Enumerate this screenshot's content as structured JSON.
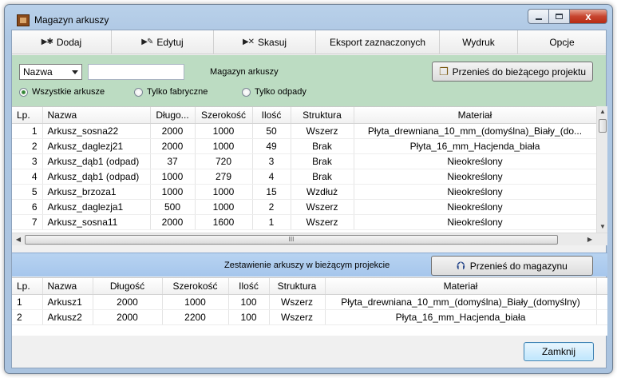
{
  "window": {
    "title": "Magazyn arkuszy",
    "close_glyph": "x"
  },
  "toolbar": {
    "items": [
      {
        "label": "Dodaj",
        "icon": "add-icon"
      },
      {
        "label": "Edytuj",
        "icon": "edit-icon"
      },
      {
        "label": "Skasuj",
        "icon": "delete-icon"
      },
      {
        "label": "Eksport zaznaczonych"
      },
      {
        "label": "Wydruk"
      },
      {
        "label": "Opcje"
      }
    ]
  },
  "filter": {
    "field_select": "Nazwa",
    "search_value": "",
    "section_label": "Magazyn arkuszy",
    "transfer_button": "Przenieś do bieżącego projektu",
    "radios": [
      {
        "label": "Wszystkie arkusze",
        "checked": true
      },
      {
        "label": "Tylko fabryczne",
        "checked": false
      },
      {
        "label": "Tylko odpady",
        "checked": false
      }
    ]
  },
  "storage_table": {
    "columns": [
      "Lp.",
      "Nazwa",
      "Długo...",
      "Szerokość",
      "Ilość",
      "Struktura",
      "Materiał"
    ],
    "rows": [
      [
        "1",
        "Arkusz_sosna22",
        "2000",
        "1000",
        "50",
        "Wszerz",
        "Płyta_drewniana_10_mm_(domyślna)_Biały_(do..."
      ],
      [
        "2",
        "Arkusz_daglezj21",
        "2000",
        "1000",
        "49",
        "Brak",
        "Płyta_16_mm_Hacjenda_biała"
      ],
      [
        "3",
        "Arkusz_dąb1 (odpad)",
        "37",
        "720",
        "3",
        "Brak",
        "Nieokreślony"
      ],
      [
        "4",
        "Arkusz_dąb1 (odpad)",
        "1000",
        "279",
        "4",
        "Brak",
        "Nieokreślony"
      ],
      [
        "5",
        "Arkusz_brzoza1",
        "1000",
        "1000",
        "15",
        "Wzdłuż",
        "Nieokreślony"
      ],
      [
        "6",
        "Arkusz_daglezja1",
        "500",
        "1000",
        "2",
        "Wszerz",
        "Nieokreślony"
      ],
      [
        "7",
        "Arkusz_sosna11",
        "2000",
        "1600",
        "1",
        "Wszerz",
        "Nieokreślony"
      ]
    ],
    "hscroll_grip": "III"
  },
  "project_summary": {
    "title": "Zestawienie arkuszy w bieżącym projekcie",
    "transfer_button": "Przenieś do magazynu",
    "columns": [
      "Lp.",
      "Nazwa",
      "Długość",
      "Szerokość",
      "Ilość",
      "Struktura",
      "Materiał"
    ],
    "rows": [
      [
        "1",
        "Arkusz1",
        "2000",
        "1000",
        "100",
        "Wszerz",
        "Płyta_drewniana_10_mm_(domyślna)_Biały_(domyślny)"
      ],
      [
        "2",
        "Arkusz2",
        "2000",
        "2200",
        "100",
        "Wszerz",
        "Płyta_16_mm_Hacjenda_biała"
      ]
    ]
  },
  "footer": {
    "close_button": "Zamknij"
  }
}
